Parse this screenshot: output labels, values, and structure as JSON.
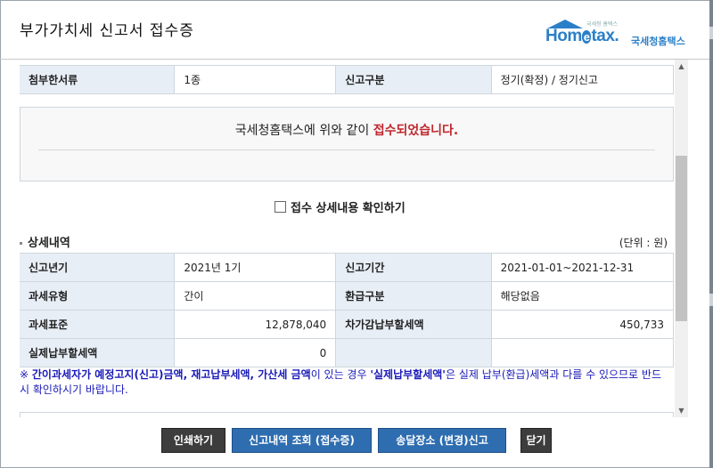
{
  "window": {
    "title": "부가가치세 신고서 접수증",
    "logo_small": "국세청 홈택스",
    "logo_main": "Hom",
    "logo_e": "e",
    "logo_tail": "tax.",
    "logo_kor": "국세청홈택스"
  },
  "top_row": {
    "attach_label": "첨부한서류",
    "attach_value": "1종",
    "type_label": "신고구분",
    "type_value": "정기(확정) / 정기신고"
  },
  "notice": {
    "prefix": "국세청홈택스에 위와 같이 ",
    "highlight": "접수되었습니다."
  },
  "confirm_checkbox": {
    "label": "접수 상세내용 확인하기",
    "checked": false
  },
  "details": {
    "section_title": "상세내역",
    "unit": "(단위 : 원)",
    "rows": [
      {
        "l1": "신고년기",
        "v1": "2021년 1기",
        "l2": "신고기간",
        "v2": "2021-01-01~2021-12-31"
      },
      {
        "l1": "과세유형",
        "v1": "간이",
        "l2": "환급구분",
        "v2": "해당없음"
      },
      {
        "l1": "과세표준",
        "v1": "12,878,040",
        "l2": "차가감납부할세액",
        "v2": "450,733"
      },
      {
        "l1": "실제납부할세액",
        "v1": "0",
        "l2": "",
        "v2": ""
      }
    ]
  },
  "warning": {
    "mark": "※ ",
    "bold1": "간이과세자가 예정고지(신고)금액, 재고납부세액, 가산세 금액",
    "mid": "이 있는 경우 ",
    "quoted": "'실제납부할세액'",
    "tail": "은 실제 납부(환급)세액과 다를 수 있으므로 반드시 확인하시기 바랍니다."
  },
  "buttons": {
    "print": "인쇄하기",
    "query": "신고내역 조회 (접수증)",
    "delivery": "송달장소 (변경)신고",
    "close": "닫기"
  }
}
